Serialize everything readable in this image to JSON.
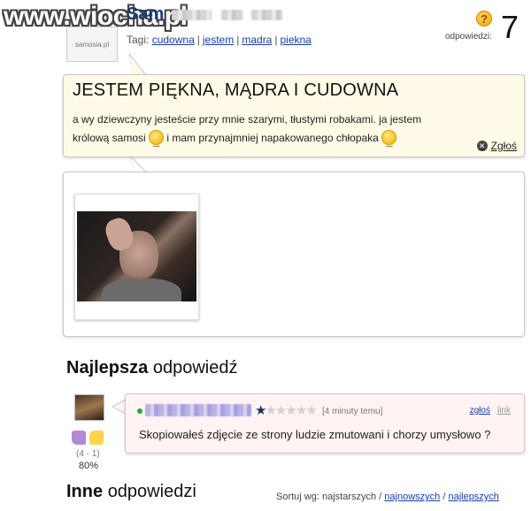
{
  "watermark": {
    "text": "www.wiocha.pl"
  },
  "question": {
    "author": "Sam",
    "avatar_text": "samosia.pl",
    "tags_label": "Tagi:",
    "tags": [
      "cudowna",
      "jestem",
      "madra",
      "piekna"
    ],
    "answers_label": "odpowiedzi:",
    "answers_count": "7",
    "title": "JESTEM PIĘKNA, MĄDRA I CUDOWNA",
    "body_1": "a wy dziewczyny jesteście przy mnie szarymi, tłustymi robakami. ja jestem",
    "body_2a": "królową samosi",
    "body_2b": "i mam przynajmniej napakowanego chłopaka",
    "report_label": "Zgłoś"
  },
  "best": {
    "heading_bold": "Najlepsza",
    "heading_rest": "odpowiedź",
    "votes": "(4 - 1)",
    "percent": "80%",
    "time": "[4 minuty temu]",
    "report_label": "zgłoś",
    "link_label": "link",
    "rating": 1,
    "max_rating": 6,
    "text": "Skopiowałeś zdjęcie ze strony ludzie zmutowani i chorzy umysłowo ?"
  },
  "others": {
    "heading_bold": "Inne",
    "heading_rest": "odpowiedzi",
    "sort_label": "Sortuj wg:",
    "sort_options": [
      "najstarszych",
      "najnowszych",
      "najlepszych"
    ]
  },
  "colors": {
    "question_bg": "#fffbe6",
    "answer_bg": "#fff3f3",
    "link": "#1a3cb0",
    "title_blue": "#1a3c6e"
  }
}
